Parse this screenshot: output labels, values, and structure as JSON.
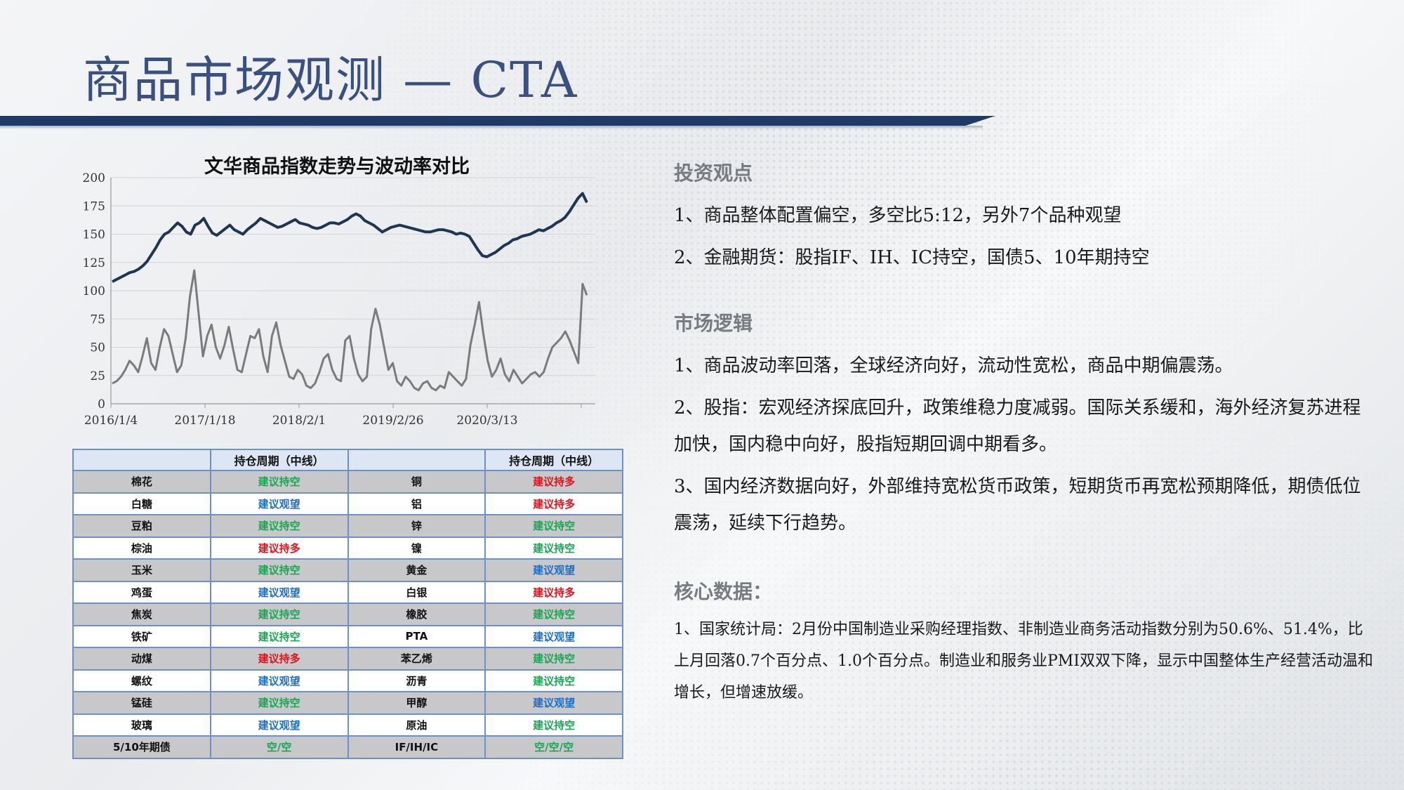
{
  "title": "商品市场观测 — CTA",
  "colors": {
    "title": "#3a5180",
    "bar": "#1f3a68",
    "index_line": "#1e3553",
    "vol_line": "#7b7b7b",
    "short": "#1aa655",
    "long": "#e0141e",
    "watch": "#1f6fc8"
  },
  "chart_data": {
    "type": "line",
    "title": "文华商品指数走势与波动率对比",
    "ylim": [
      0,
      200
    ],
    "yticks": [
      "0",
      "25",
      "50",
      "75",
      "100",
      "125",
      "150",
      "175",
      "200"
    ],
    "xtick_labels": [
      "2016/1/4",
      "2017/1/18",
      "2018/2/1",
      "2019/2/26",
      "2020/3/13"
    ],
    "grid": "horizontal",
    "series": [
      {
        "values": [
          108,
          110,
          112,
          114,
          116,
          117,
          119,
          122,
          126,
          132,
          138,
          145,
          150,
          152,
          156,
          160,
          157,
          152,
          150,
          158,
          160,
          164,
          157,
          151,
          149,
          152,
          155,
          158,
          154,
          152,
          150,
          154,
          157,
          160,
          164,
          162,
          160,
          158,
          156,
          157,
          159,
          161,
          163,
          160,
          159,
          158,
          156,
          155,
          156,
          158,
          160,
          160,
          159,
          161,
          163,
          166,
          168,
          166,
          162,
          160,
          158,
          155,
          152,
          154,
          156,
          157,
          158,
          157,
          156,
          155,
          154,
          153,
          152,
          152,
          153,
          154,
          154,
          153,
          152,
          150,
          151,
          150,
          148,
          142,
          136,
          131,
          130,
          132,
          134,
          137,
          140,
          142,
          145,
          146,
          148,
          149,
          150,
          152,
          154,
          153,
          155,
          157,
          160,
          162,
          165,
          170,
          176,
          182,
          186,
          178
        ]
      },
      {
        "values": [
          18,
          20,
          24,
          30,
          38,
          34,
          28,
          42,
          58,
          36,
          30,
          50,
          66,
          60,
          44,
          28,
          34,
          58,
          95,
          118,
          80,
          42,
          60,
          70,
          50,
          40,
          52,
          68,
          48,
          30,
          28,
          44,
          60,
          58,
          66,
          42,
          28,
          60,
          72,
          52,
          38,
          24,
          22,
          30,
          26,
          16,
          14,
          18,
          28,
          40,
          44,
          30,
          22,
          20,
          56,
          60,
          40,
          26,
          20,
          24,
          66,
          84,
          70,
          50,
          30,
          36,
          20,
          16,
          24,
          20,
          14,
          12,
          18,
          20,
          14,
          12,
          16,
          14,
          28,
          24,
          20,
          16,
          22,
          52,
          70,
          90,
          62,
          38,
          24,
          30,
          40,
          26,
          20,
          30,
          24,
          18,
          22,
          26,
          28,
          24,
          28,
          40,
          50,
          54,
          58,
          64,
          56,
          46,
          36,
          106,
          96
        ]
      }
    ]
  },
  "table": {
    "header": [
      "",
      "持仓周期（中线）",
      "",
      "持仓周期（中线）"
    ],
    "rows": [
      {
        "c1": "棉花",
        "s1": "建议持空",
        "t1": "short",
        "c2": "铜",
        "s2": "建议持多",
        "t2": "long"
      },
      {
        "c1": "白糖",
        "s1": "建议观望",
        "t1": "watch",
        "c2": "铝",
        "s2": "建议持多",
        "t2": "long"
      },
      {
        "c1": "豆粕",
        "s1": "建议持空",
        "t1": "short",
        "c2": "锌",
        "s2": "建议持空",
        "t2": "short"
      },
      {
        "c1": "棕油",
        "s1": "建议持多",
        "t1": "long",
        "c2": "镍",
        "s2": "建议持空",
        "t2": "short"
      },
      {
        "c1": "玉米",
        "s1": "建议持空",
        "t1": "short",
        "c2": "黄金",
        "s2": "建议观望",
        "t2": "watch"
      },
      {
        "c1": "鸡蛋",
        "s1": "建议观望",
        "t1": "watch",
        "c2": "白银",
        "s2": "建议持多",
        "t2": "long"
      },
      {
        "c1": "焦炭",
        "s1": "建议持空",
        "t1": "short",
        "c2": "橡胶",
        "s2": "建议持空",
        "t2": "short"
      },
      {
        "c1": "铁矿",
        "s1": "建议持空",
        "t1": "short",
        "c2": "PTA",
        "s2": "建议观望",
        "t2": "watch"
      },
      {
        "c1": "动煤",
        "s1": "建议持多",
        "t1": "long",
        "c2": "苯乙烯",
        "s2": "建议持空",
        "t2": "short"
      },
      {
        "c1": "螺纹",
        "s1": "建议观望",
        "t1": "watch",
        "c2": "沥青",
        "s2": "建议持空",
        "t2": "short"
      },
      {
        "c1": "锰硅",
        "s1": "建议持空",
        "t1": "short",
        "c2": "甲醇",
        "s2": "建议观望",
        "t2": "watch"
      },
      {
        "c1": "玻璃",
        "s1": "建议观望",
        "t1": "watch",
        "c2": "原油",
        "s2": "建议持空",
        "t2": "short"
      },
      {
        "c1": "5/10年期债",
        "s1": "空/空",
        "t1": "short",
        "c2": "IF/IH/IC",
        "s2": "空/空/空",
        "t2": "short"
      }
    ]
  },
  "sections": {
    "invest": {
      "heading": "投资观点",
      "items": [
        "1、商品整体配置偏空，多空比5:12，另外7个品种观望",
        "2、金融期货：股指IF、IH、IC持空，国债5、10年期持空"
      ]
    },
    "logic": {
      "heading": "市场逻辑",
      "items": [
        "1、商品波动率回落，全球经济向好，流动性宽松，商品中期偏震荡。",
        "2、股指：宏观经济探底回升，政策维稳力度减弱。国际关系缓和，海外经济复苏进程加快，国内稳中向好，股指短期回调中期看多。",
        "3、国内经济数据向好，外部维持宽松货币政策，短期货币再宽松预期降低，期债低位震荡，延续下行趋势。"
      ]
    },
    "core": {
      "heading": "核心数据：",
      "items": [
        "1、国家统计局：2月份中国制造业采购经理指数、非制造业商务活动指数分别为50.6%、51.4%，比上月回落0.7个百分点、1.0个百分点。制造业和服务业PMI双双下降，显示中国整体生产经营活动温和增长，但增速放缓。"
      ]
    }
  }
}
